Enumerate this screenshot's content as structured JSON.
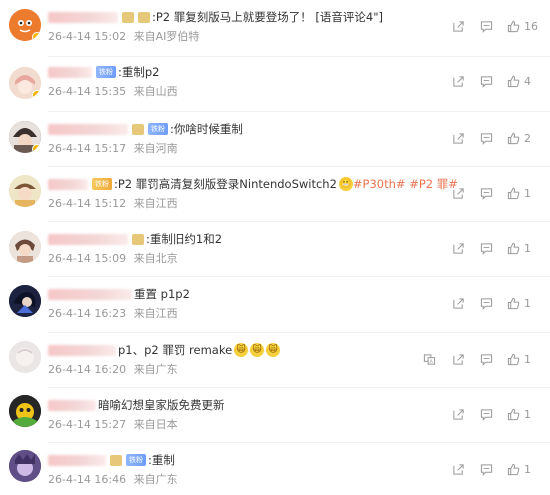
{
  "comments": [
    {
      "text": ":P2 罪复刻版马上就要登场了！ [语音评论4\"]",
      "time": "26-4-14 15:02",
      "source": "来自AI罗伯特",
      "likes": "16",
      "badge": "",
      "name_w": 70
    },
    {
      "text": ":重制p2",
      "time": "26-4-14 15:35",
      "source": "来自山西",
      "likes": "4",
      "badge": "铁粉",
      "name_w": 44
    },
    {
      "text": ":你啥时候重制",
      "time": "26-4-14 15:17",
      "source": "来自河南",
      "likes": "2",
      "badge": "铁粉",
      "name_w": 80
    },
    {
      "text": ":P2 罪罚高清复刻版登录NintendoSwitch2",
      "hashtags": "#P30th# #P2 罪#",
      "time": "26-4-14 15:12",
      "source": "来自江西",
      "likes": "1",
      "badge": "铁粉",
      "name_w": 40
    },
    {
      "text": ":重制旧约1和2",
      "time": "26-4-14 15:09",
      "source": "来自北京",
      "likes": "1",
      "badge": "",
      "name_w": 80
    },
    {
      "text": "重置 p1p2",
      "time": "26-4-14 16:23",
      "source": "来自江西",
      "likes": "1",
      "badge": "",
      "name_w": 84
    },
    {
      "text": "p1、p2 罪罚 remake",
      "time": "26-4-14 16:20",
      "source": "来自广东",
      "likes": "1",
      "badge": "",
      "name_w": 68
    },
    {
      "text": "暗喻幻想皇家版免费更新",
      "time": "26-4-14 15:27",
      "source": "来自日本",
      "likes": "1",
      "badge": "",
      "name_w": 48
    },
    {
      "text": ":重制",
      "time": "26-4-14 16:46",
      "source": "来自广东",
      "likes": "1",
      "badge": "铁粉",
      "name_w": 58
    }
  ],
  "colors": {
    "hashtag": "#eb7350",
    "meta": "#999999",
    "text": "#333333"
  },
  "icons": {
    "share": "share-icon",
    "comment": "comment-icon",
    "like": "like-icon",
    "report": "translate-icon"
  }
}
